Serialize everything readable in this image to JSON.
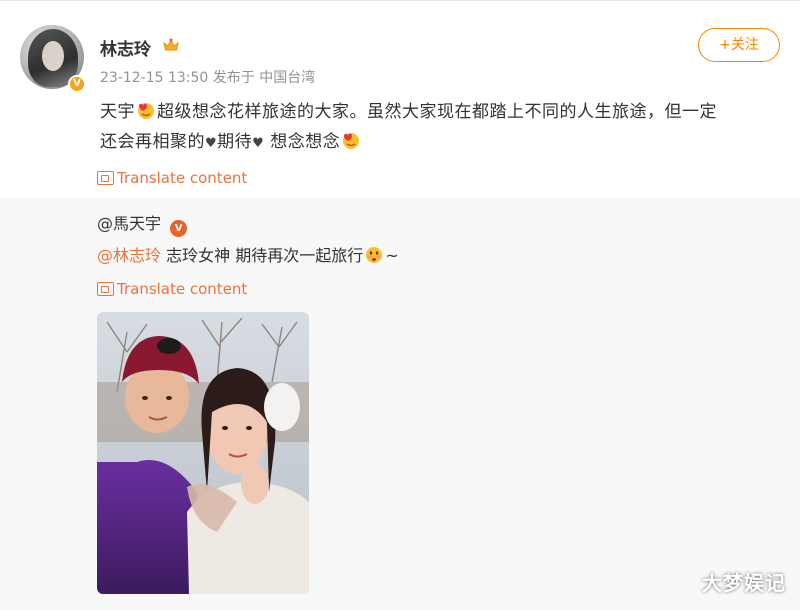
{
  "post": {
    "username": "林志玲",
    "crown_icon": "crown-icon",
    "verified_icon": "verified-badge-icon",
    "verified_glyph": "V",
    "timestamp": "23-12-15 13:50",
    "location": "发布于 中国台湾",
    "follow_label": "+关注",
    "text": {
      "part1": "天宇",
      "part2": "超级想念花样旅途的大家。虽然大家现在都踏上不同的人生旅途，但一定",
      "part3": "还会再相聚的",
      "heart": "♥",
      "part4": "期待",
      "part5": "想念想念"
    },
    "translate_label": "Translate content"
  },
  "repost": {
    "user": "@馬天宇",
    "verified_glyph": "V",
    "mention": "@林志玲",
    "text": " 志玲女神 期待再次一起旅行",
    "tail": "~",
    "translate_label": "Translate content"
  },
  "watermark": "大梦娱记",
  "colors": {
    "accent": "#ff8200",
    "link": "#eb7340",
    "verified": "#f7a21a",
    "repost_bg": "#f8f8f8"
  }
}
